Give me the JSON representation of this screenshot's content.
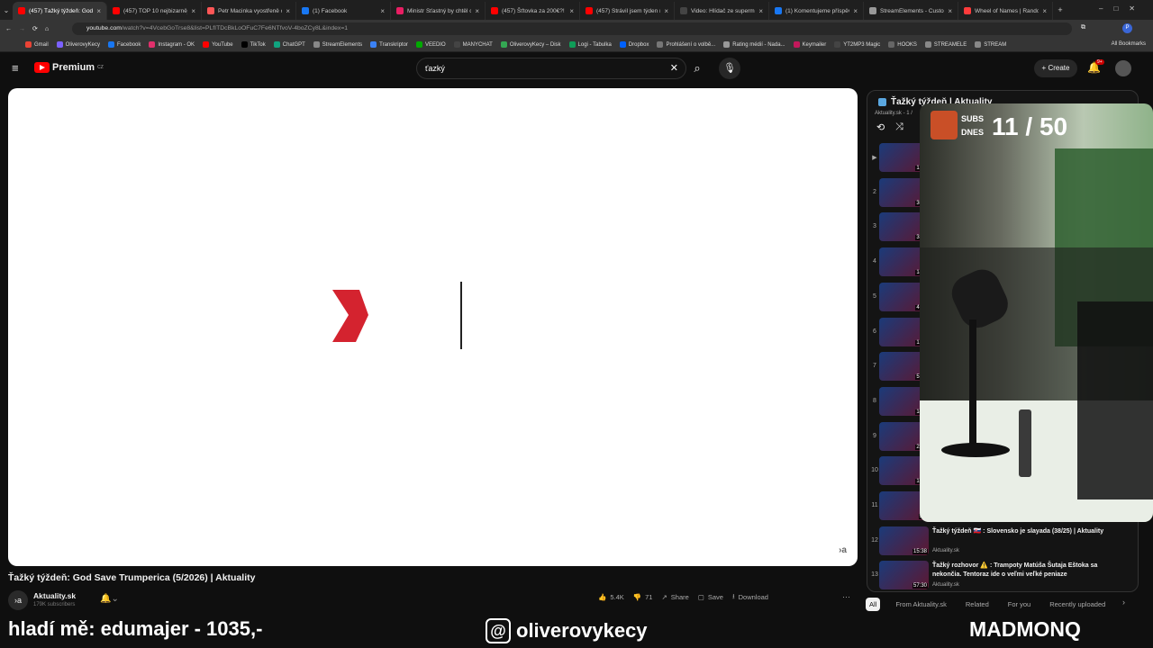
{
  "browser": {
    "tabs": [
      {
        "label": "(457) Ťažký týždeň: God S",
        "active": true,
        "color": "#ff0000"
      },
      {
        "label": "(457) TOP 10 nejbizarněji",
        "active": false,
        "color": "#ff0000"
      },
      {
        "label": "Petr Macinka vyostřeně o",
        "active": false,
        "color": "#ff5656"
      },
      {
        "label": "(1) Facebook",
        "active": false,
        "color": "#1877f2"
      },
      {
        "label": "Ministr Šťastný by chtěl c",
        "active": false,
        "color": "#e91e63"
      },
      {
        "label": "(457) Šťtovka za 200€?! 🎖",
        "active": false,
        "color": "#ff0000"
      },
      {
        "label": "(457) Strávil jsem týden m",
        "active": false,
        "color": "#ff0000"
      },
      {
        "label": "Video: Hlídač ze superma",
        "active": false,
        "color": "#444444"
      },
      {
        "label": "(1) Komentujeme příspěv",
        "active": false,
        "color": "#1877f2"
      },
      {
        "label": "StreamElements - Custom",
        "active": false,
        "color": "#999999"
      },
      {
        "label": "Wheel of Names | Rando",
        "active": false,
        "color": "#ff3b3b"
      }
    ],
    "new_tab": "+",
    "url_host": "youtube.com",
    "url_path": "/watch?v=4VcebGoTrse8&list=PLfITDcBkLoOFuC7Fe6NTfvoV-4boZCy8L&index=1",
    "bookmarks": [
      "Gmail",
      "OliverovyKecy",
      "Facebook",
      "Instagram - OK",
      "YouTube",
      "TikTok",
      "ChatGPT",
      "StreamElements",
      "Transkriptor",
      "VEEDIO",
      "MANYCHAT",
      "OliverovyKecy – Disk",
      "Logi - Tabulka",
      "Dropbox",
      "Prohlášení o volbě...",
      "Rating médií - Nada...",
      "Keymailer",
      "YT2MP3 Magic",
      "HOOKS",
      "STREAMELE",
      "STREAM"
    ],
    "all_bookmarks": "All Bookmarks"
  },
  "youtube": {
    "brand": "Premium",
    "region": "CZ",
    "search_value": "ťazký",
    "create_label": "Create",
    "notifications_badge": "9+",
    "player_watermark": "›a",
    "video_title": "Ťažký týždeň: God Save Trumperica (5/2026) | Aktuality",
    "channel_name": "Aktuality.sk",
    "channel_subs": "179K subscribers",
    "channel_avatar": "›a",
    "actions": [
      {
        "icon": "thumb-up",
        "label": "5.4K"
      },
      {
        "icon": "thumb-down",
        "label": "71"
      },
      {
        "icon": "share",
        "label": "Share"
      },
      {
        "icon": "save",
        "label": "Save"
      },
      {
        "icon": "download",
        "label": "Download"
      }
    ],
    "more_label": "···",
    "playlist": {
      "title": "Ťažký týždeň | Aktuality",
      "sub": "Aktuality.sk - 1 /",
      "items": [
        {
          "num": "▶",
          "duration": "13:3",
          "title": "",
          "channel": ""
        },
        {
          "num": "2",
          "duration": "30:0",
          "title": "",
          "channel": ""
        },
        {
          "num": "3",
          "duration": "35:1",
          "title": "",
          "channel": ""
        },
        {
          "num": "4",
          "duration": "14:2",
          "title": "",
          "channel": ""
        },
        {
          "num": "5",
          "duration": "46:5",
          "title": "",
          "channel": ""
        },
        {
          "num": "6",
          "duration": "12:5",
          "title": "",
          "channel": ""
        },
        {
          "num": "7",
          "duration": "57:1",
          "title": "",
          "channel": ""
        },
        {
          "num": "8",
          "duration": "14:3",
          "title": "",
          "channel": ""
        },
        {
          "num": "9",
          "duration": "22:2",
          "title": "",
          "channel": ""
        },
        {
          "num": "10",
          "duration": "17:2",
          "title": "",
          "channel": ""
        },
        {
          "num": "11",
          "duration": "9:1",
          "title": "",
          "channel": ""
        },
        {
          "num": "12",
          "duration": "15:38",
          "title": "Ťažký týždeň 🇸🇰 : Slovensko je slayada (38/25) | Aktuality",
          "channel": "Aktuality.sk"
        },
        {
          "num": "13",
          "duration": "57:30",
          "title": "Ťažký rozhovor ⚠️ : Trampoty Matúša Šutaja Eštoka sa nekončia. Tentoraz ide o veľmi veľké peniaze",
          "channel": "Aktuality.sk"
        }
      ]
    },
    "chips": [
      "All",
      "From Aktuality.sk",
      "Related",
      "For you",
      "Recently uploaded"
    ]
  },
  "stream": {
    "subs_label_1": "SUBS",
    "subs_label_2": "DNES",
    "subs_count": "11 / 50",
    "ticker": "hladí mě: edumajer - 1035,-",
    "social_handle": "oliverovykecy",
    "streamer_name": "MADMONQ"
  },
  "colors": {
    "accent": "#ff0000",
    "bg": "#0f0f0f",
    "text": "#f1f1f1"
  }
}
